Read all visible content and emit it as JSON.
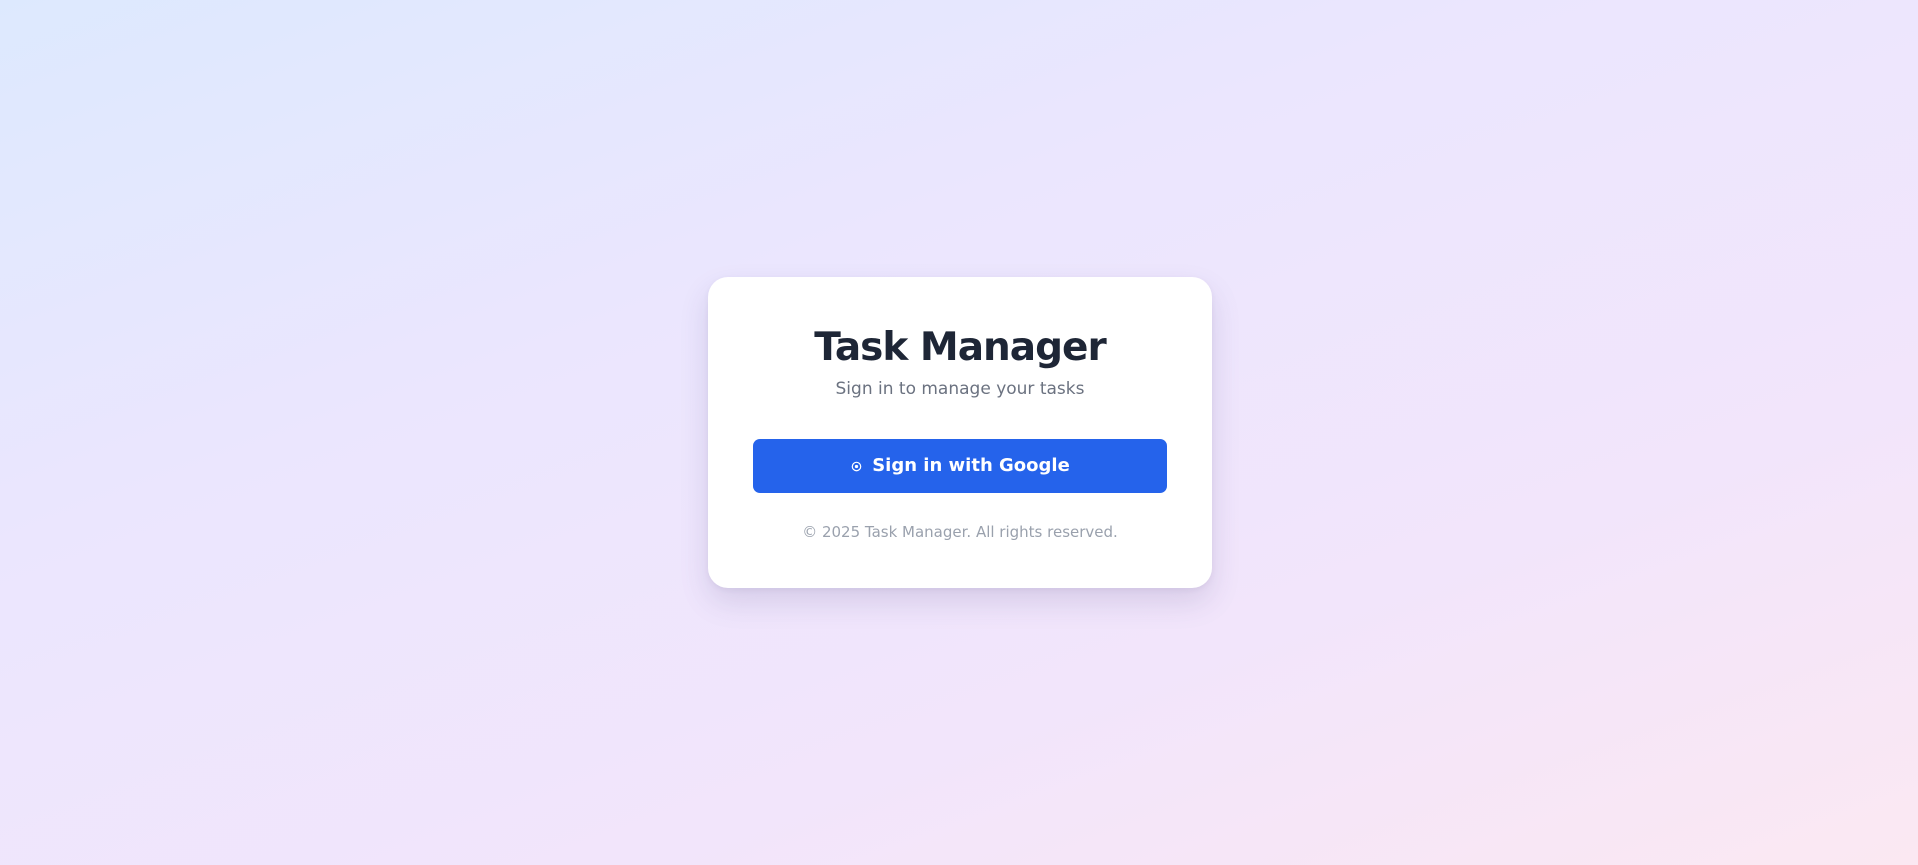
{
  "card": {
    "title": "Task Manager",
    "subtitle": "Sign in to manage your tasks",
    "signin_button": {
      "label": "Sign in with Google",
      "icon": "google-icon"
    },
    "footer": "© 2025 Task Manager. All rights reserved."
  },
  "colors": {
    "primary": "#2563eb",
    "title": "#1e2636",
    "subtitle": "#6b7280",
    "footer": "#9aa1ad",
    "card_background": "#ffffff"
  }
}
